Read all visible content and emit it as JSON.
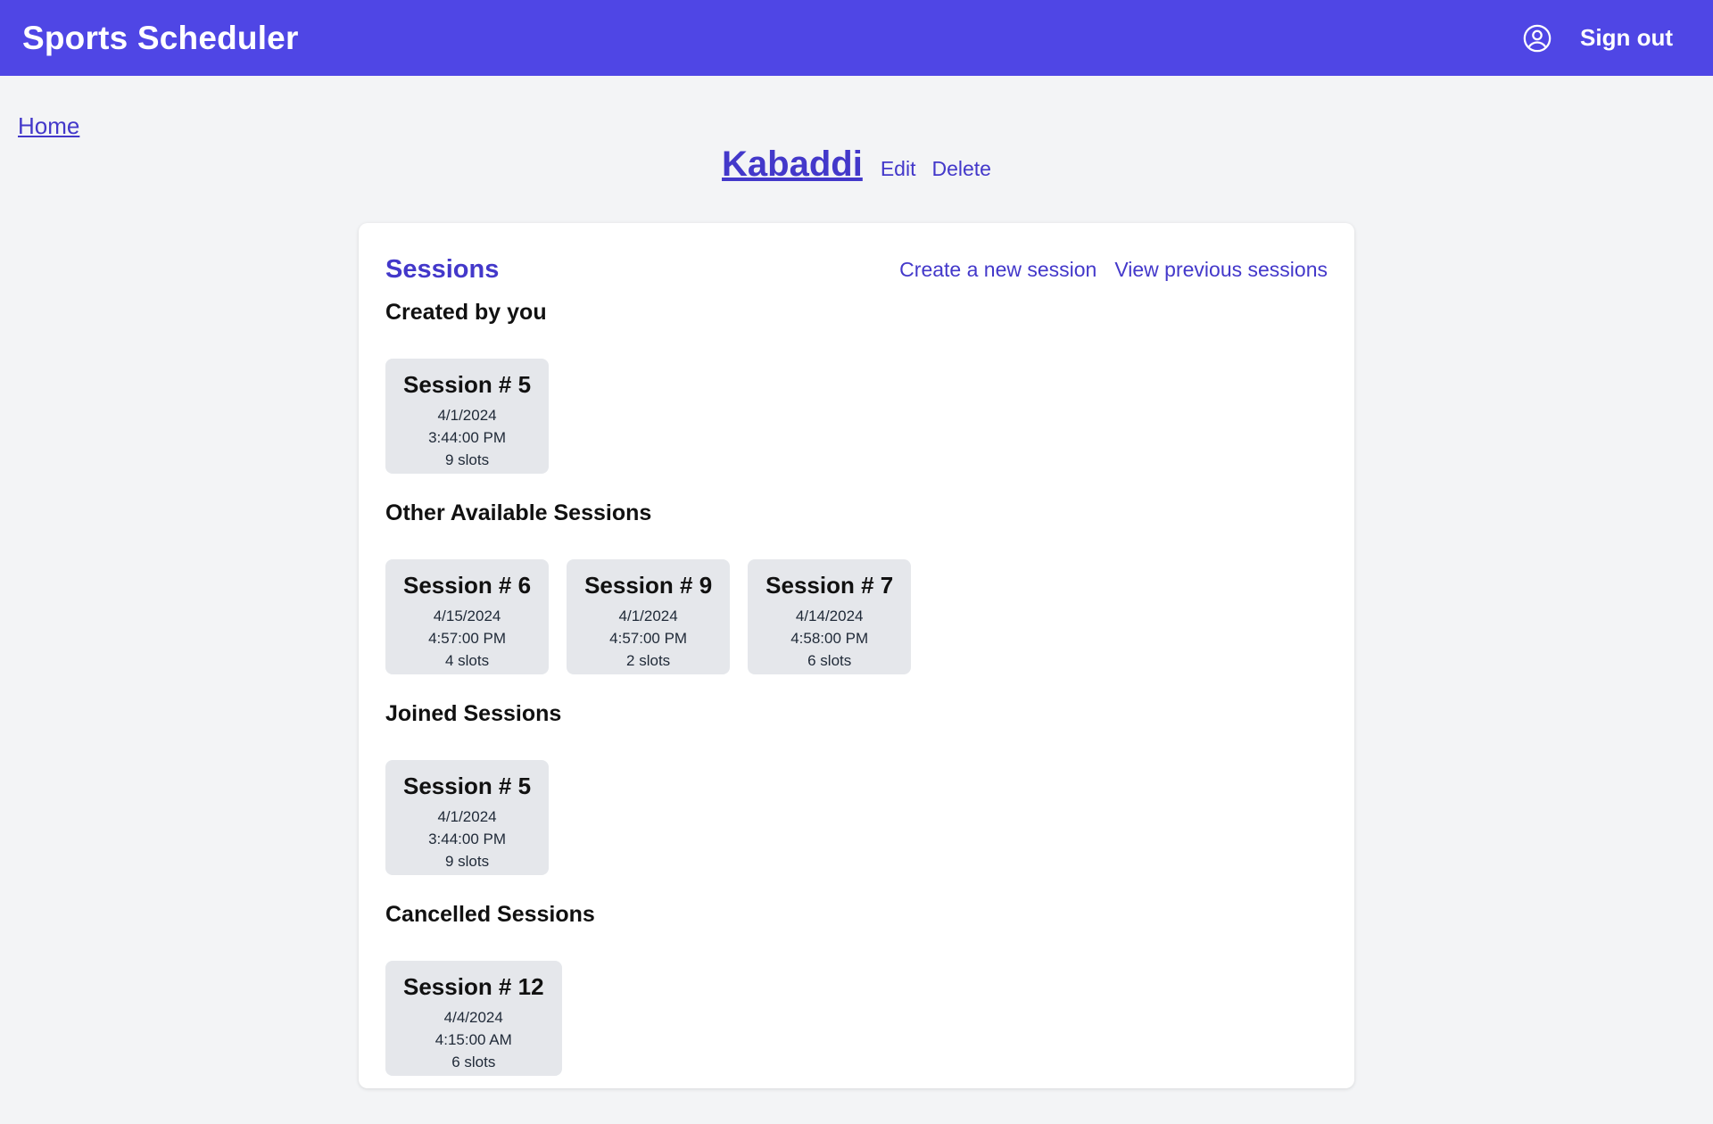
{
  "header": {
    "brand": "Sports Scheduler",
    "user_icon": "user-circle-icon",
    "signout_label": "Sign out",
    "background": "#4f46e5"
  },
  "breadcrumb": {
    "home_label": "Home"
  },
  "sport": {
    "name": "Kabaddi",
    "edit_label": "Edit",
    "delete_label": "Delete"
  },
  "sessions_panel": {
    "title": "Sessions",
    "create_label": "Create a new session",
    "previous_label": "View previous sessions",
    "sections": [
      {
        "title": "Created by you",
        "sessions": [
          {
            "name": "Session # 5",
            "date": "4/1/2024",
            "time": "3:44:00 PM",
            "slots": "9 slots"
          }
        ]
      },
      {
        "title": "Other Available Sessions",
        "sessions": [
          {
            "name": "Session # 6",
            "date": "4/15/2024",
            "time": "4:57:00 PM",
            "slots": "4 slots"
          },
          {
            "name": "Session # 9",
            "date": "4/1/2024",
            "time": "4:57:00 PM",
            "slots": "2 slots"
          },
          {
            "name": "Session # 7",
            "date": "4/14/2024",
            "time": "4:58:00 PM",
            "slots": "6 slots"
          }
        ]
      },
      {
        "title": "Joined Sessions",
        "sessions": [
          {
            "name": "Session # 5",
            "date": "4/1/2024",
            "time": "3:44:00 PM",
            "slots": "9 slots"
          }
        ]
      },
      {
        "title": "Cancelled Sessions",
        "sessions": [
          {
            "name": "Session # 12",
            "date": "4/4/2024",
            "time": "4:15:00 AM",
            "slots": "6 slots"
          }
        ]
      }
    ]
  },
  "colors": {
    "accent": "#4338ca",
    "page_background": "#f3f4f6",
    "tile_background": "#e5e7eb"
  }
}
